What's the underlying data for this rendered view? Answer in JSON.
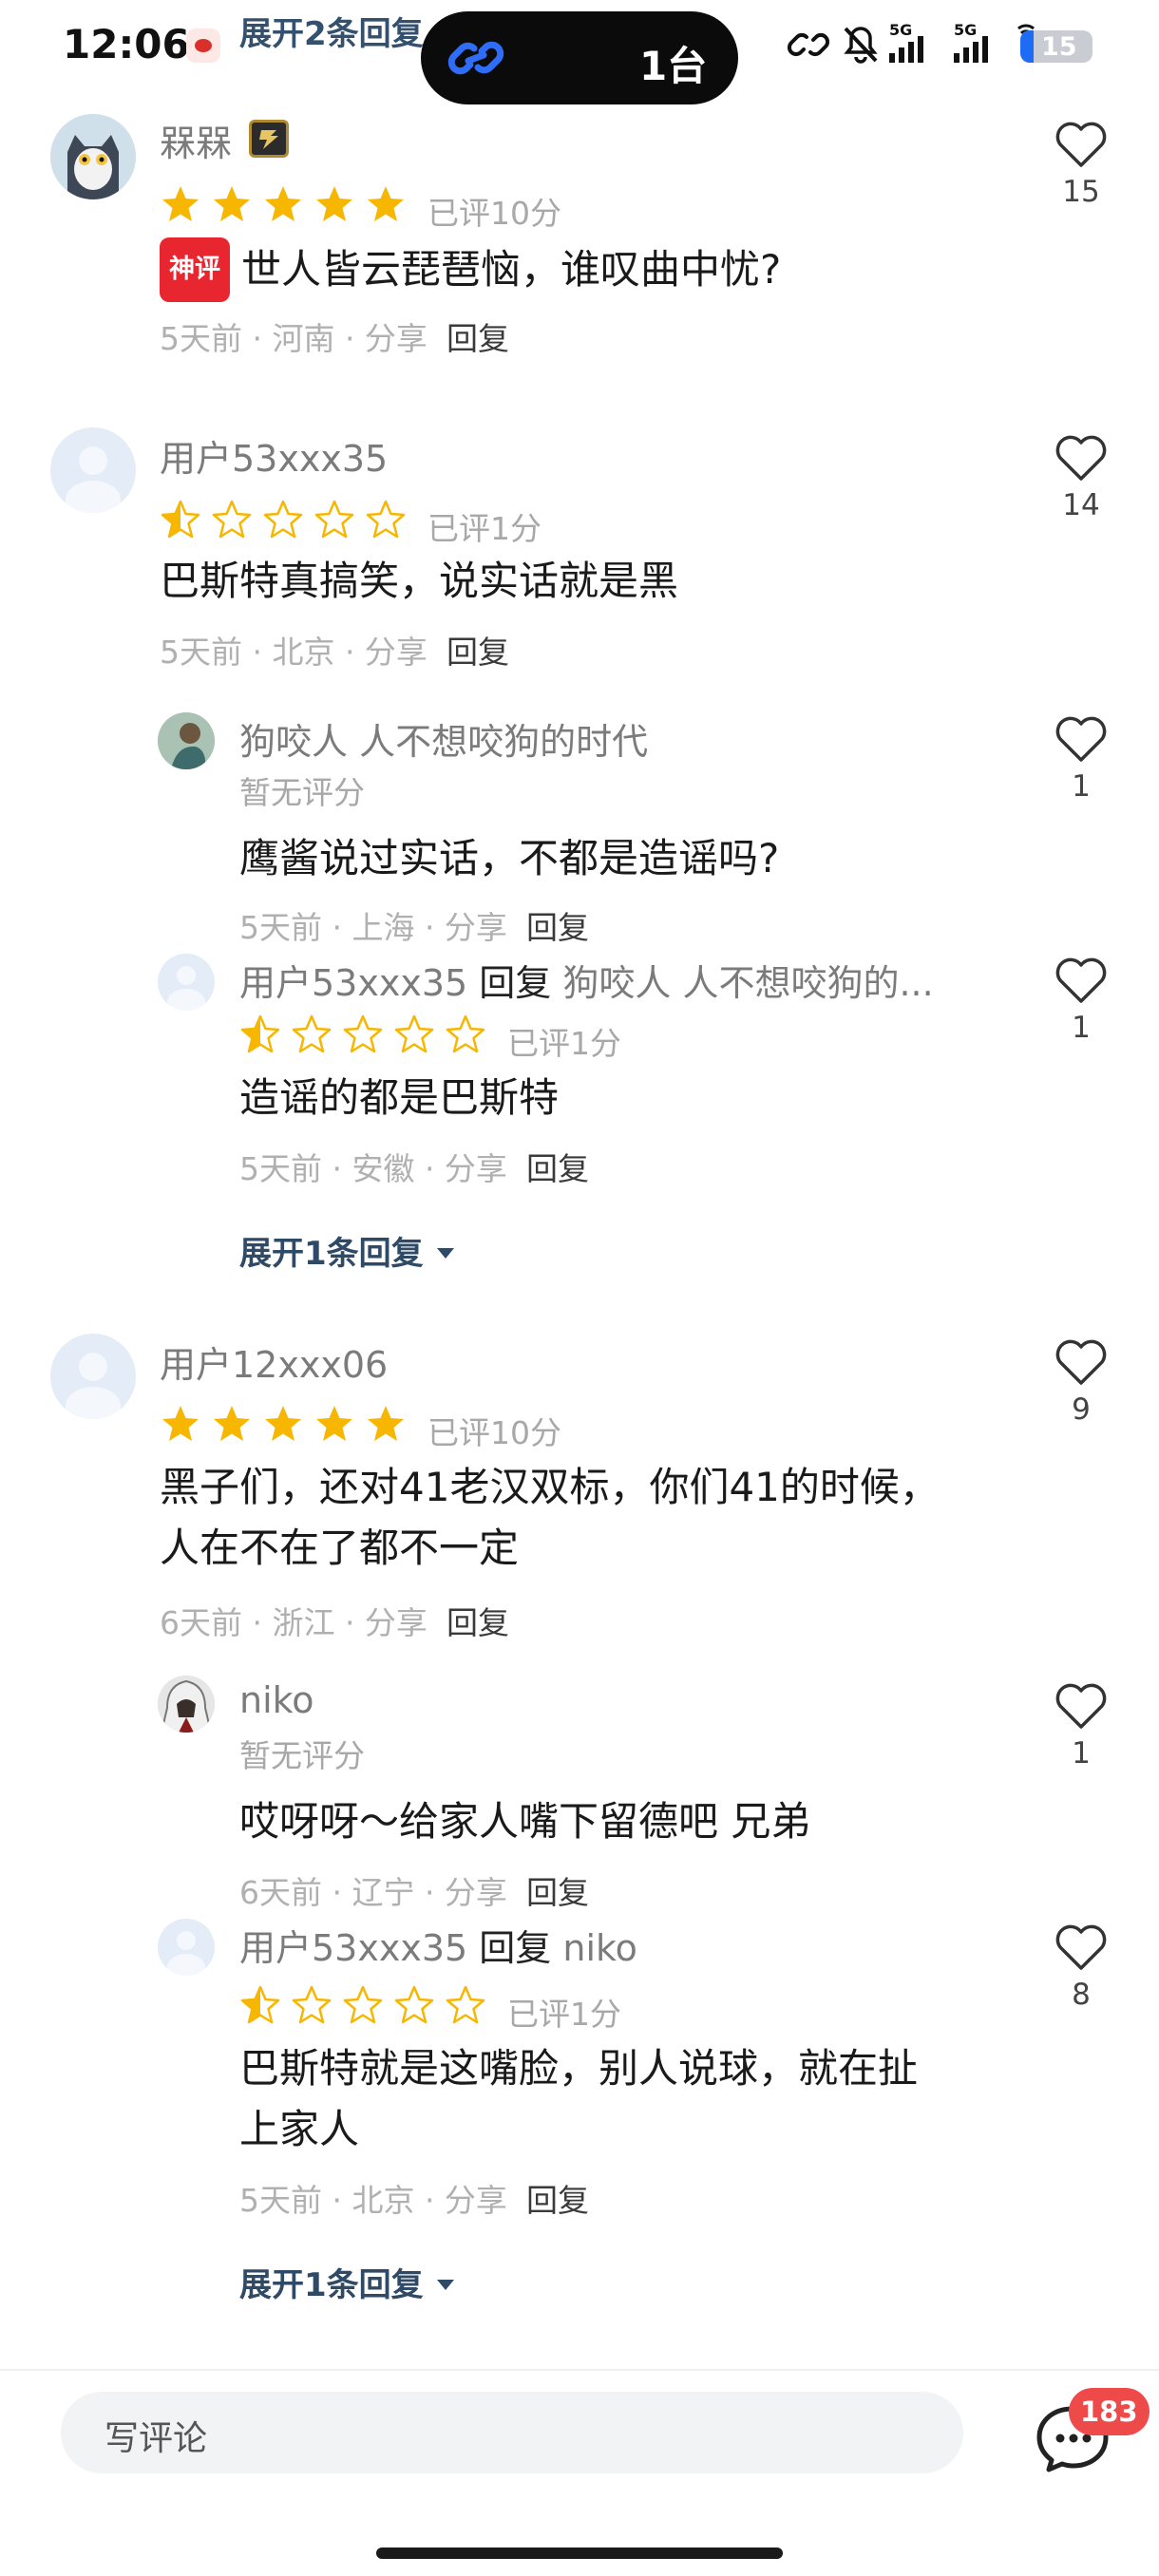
{
  "status_bar": {
    "time": "12:06",
    "expand_label": "展开2条回复",
    "island_count": "1台",
    "battery": "15"
  },
  "comments": [
    {
      "username": "槑槑",
      "stars_filled": 5,
      "rating_label": "已评10分",
      "tag": "神评",
      "text_lines": [
        "世人皆云琵琶恼，谁叹曲中忧?"
      ],
      "meta": "5天前 · 河南 · 分享",
      "reply_label": "回复",
      "likes": "15"
    },
    {
      "username": "用户53xxx35",
      "stars_filled": 0.5,
      "rating_label": "已评1分",
      "text_lines": [
        "巴斯特真搞笑，说实话就是黑"
      ],
      "meta": "5天前 · 北京 · 分享",
      "reply_label": "回复",
      "likes": "14",
      "replies": [
        {
          "username": "狗咬人 人不想咬狗的时代",
          "rating_label": "暂无评分",
          "text_lines": [
            "鹰酱说过实话，不都是造谣吗?"
          ],
          "meta": "5天前 · 上海 · 分享",
          "reply_label": "回复",
          "likes": "1"
        },
        {
          "username": "用户53xxx35",
          "reply_word": "回复",
          "reply_to": "狗咬人 人不想咬狗的...",
          "stars_filled": 0.5,
          "rating_label": "已评1分",
          "text_lines": [
            "造谣的都是巴斯特"
          ],
          "meta": "5天前 · 安徽 · 分享",
          "reply_label": "回复",
          "likes": "1"
        }
      ],
      "expand_label": "展开1条回复"
    },
    {
      "username": "用户12xxx06",
      "stars_filled": 5,
      "rating_label": "已评10分",
      "text_lines": [
        "黑子们，还对41老汉双标，你们41的时候，",
        "人在不在了都不一定"
      ],
      "meta": "6天前 · 浙江 · 分享",
      "reply_label": "回复",
      "likes": "9",
      "replies": [
        {
          "username": "niko",
          "rating_label": "暂无评分",
          "text_lines": [
            "哎呀呀～给家人嘴下留德吧 兄弟"
          ],
          "meta": "6天前 · 辽宁 · 分享",
          "reply_label": "回复",
          "likes": "1"
        },
        {
          "username": "用户53xxx35",
          "reply_word": "回复",
          "reply_to": "niko",
          "stars_filled": 0.5,
          "rating_label": "已评1分",
          "text_lines": [
            "巴斯特就是这嘴脸，别人说球，就在扯",
            "上家人"
          ],
          "meta": "5天前 · 北京 · 分享",
          "reply_label": "回复",
          "likes": "8"
        }
      ],
      "expand_label": "展开1条回复"
    }
  ],
  "bottom_bar": {
    "input_placeholder": "写评论",
    "comment_count": "183"
  },
  "colors": {
    "star": "#f7b600",
    "star_empty": "#f7b600",
    "tag_red": "#e8262f",
    "badge_red": "#ee4a4a",
    "expand_blue": "#2f4a67"
  }
}
